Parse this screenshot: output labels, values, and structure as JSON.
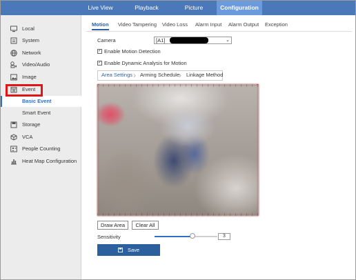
{
  "topnav": {
    "tabs": [
      {
        "label": "Live View"
      },
      {
        "label": "Playback"
      },
      {
        "label": "Picture"
      },
      {
        "label": "Configuration",
        "active": true
      }
    ]
  },
  "sidebar": {
    "items": [
      {
        "label": "Local",
        "icon": "monitor-icon"
      },
      {
        "label": "System",
        "icon": "system-icon"
      },
      {
        "label": "Network",
        "icon": "globe-icon"
      },
      {
        "label": "Video/Audio",
        "icon": "video-audio-icon"
      },
      {
        "label": "Image",
        "icon": "image-icon"
      },
      {
        "label": "Event",
        "icon": "calendar-icon",
        "highlighted": true
      },
      {
        "label": "Basic Event",
        "sub": true,
        "active": true
      },
      {
        "label": "Smart Event",
        "sub": true
      },
      {
        "label": "Storage",
        "icon": "storage-icon"
      },
      {
        "label": "VCA",
        "icon": "vca-icon"
      },
      {
        "label": "People Counting",
        "icon": "people-counting-icon"
      },
      {
        "label": "Heat Map Configuration",
        "icon": "heat-map-icon"
      }
    ]
  },
  "subtabs": [
    {
      "label": "Motion",
      "active": true
    },
    {
      "label": "Video Tampering"
    },
    {
      "label": "Video Loss"
    },
    {
      "label": "Alarm Input"
    },
    {
      "label": "Alarm Output"
    },
    {
      "label": "Exception"
    }
  ],
  "form": {
    "camera_label": "Camera",
    "camera_value": "[A1]",
    "enable_motion_label": "Enable Motion Detection",
    "enable_motion_checked": true,
    "enable_dynamic_label": "Enable Dynamic Analysis for Motion",
    "enable_dynamic_checked": true
  },
  "steps": [
    {
      "label": "Area Settings",
      "active": true
    },
    {
      "label": "Arming Schedule"
    },
    {
      "label": "Linkage Method"
    }
  ],
  "area": {
    "draw_area_label": "Draw Area",
    "clear_all_label": "Clear All",
    "sensitivity_label": "Sensitivity",
    "sensitivity_value": "3",
    "sensitivity_fraction": 0.6
  },
  "save_label": "Save",
  "colors": {
    "topnav": "#4a78b9",
    "accent": "#2a5fa8",
    "save": "#2b5f9e",
    "highlight": "#e01616"
  }
}
